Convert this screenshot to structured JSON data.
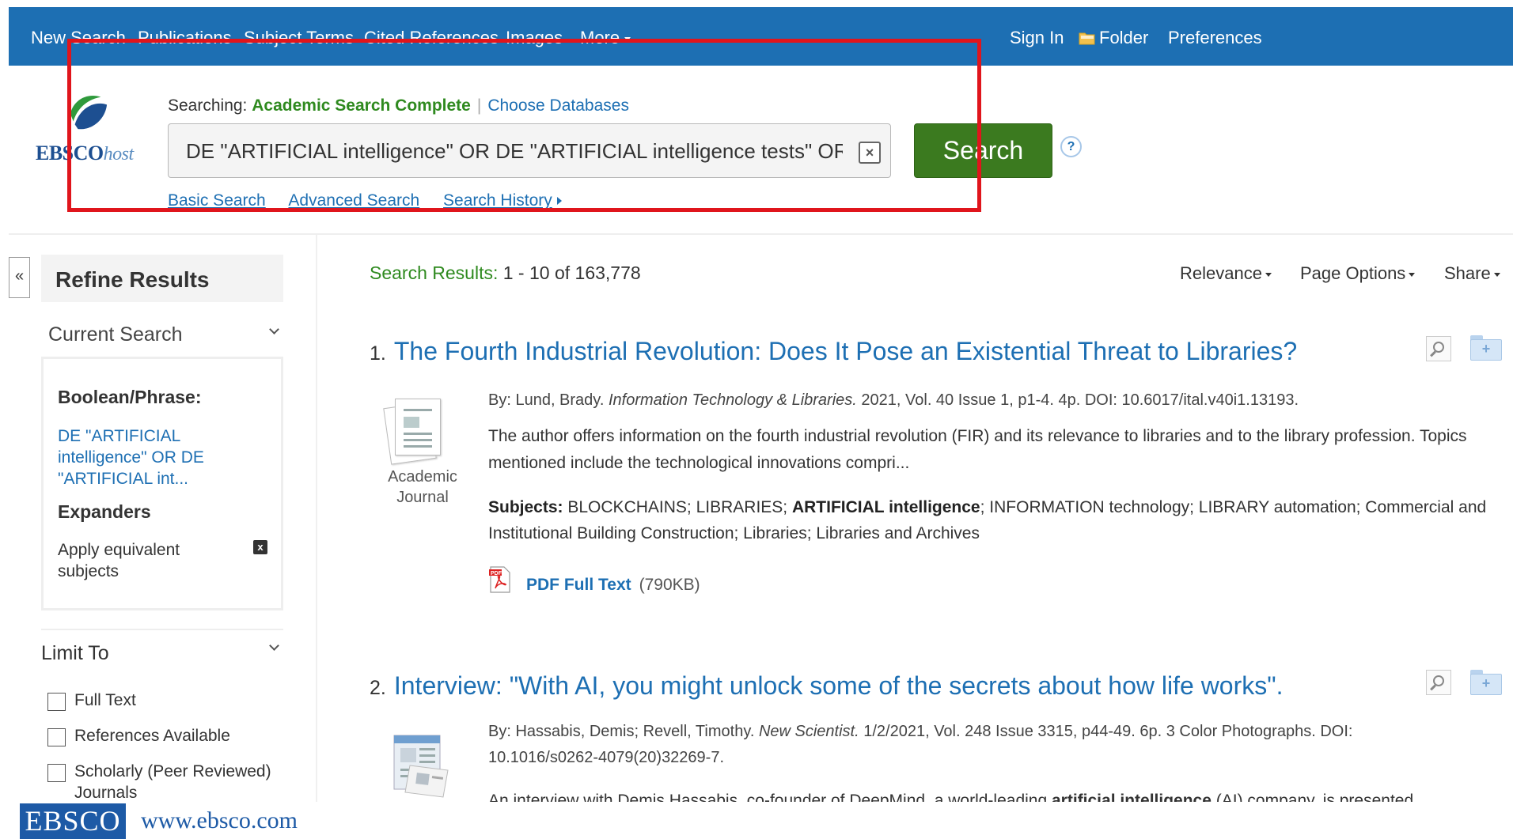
{
  "topnav": {
    "new_search": "New Search",
    "publications": "Publications",
    "subject_terms": "Subject Terms",
    "cited_references": "Cited References",
    "images": "Images",
    "more": "More",
    "sign_in": "Sign In",
    "folder": "Folder",
    "preferences": "Preferences"
  },
  "logo": {
    "ebsco": "EBSCO",
    "host": "host"
  },
  "search": {
    "searching_label": "Searching:",
    "database": "Academic Search Complete",
    "choose_databases": "Choose Databases",
    "query": "DE \"ARTIFICIAL intelligence\" OR DE \"ARTIFICIAL intelligence tests\" OR",
    "clear": "×",
    "button": "Search",
    "help": "?",
    "basic": "Basic Search",
    "advanced": "Advanced Search",
    "history": "Search History"
  },
  "sidebar": {
    "collapse": "«",
    "refine_title": "Refine Results",
    "current_search": "Current Search",
    "boolean_label": "Boolean/Phrase:",
    "boolean_value": "DE \"ARTIFICIAL intelligence\" OR DE \"ARTIFICIAL int...",
    "expanders_label": "Expanders",
    "expander_value": "Apply equivalent subjects",
    "remove": "x",
    "limit_to": "Limit To",
    "limits": [
      {
        "label": "Full Text"
      },
      {
        "label": "References Available"
      },
      {
        "label": "Scholarly (Peer Reviewed) Journals"
      }
    ]
  },
  "results": {
    "count_label": "Search Results:",
    "count_value": "1 - 10 of 163,778",
    "relevance": "Relevance",
    "page_options": "Page Options",
    "share": "Share",
    "items": [
      {
        "num": "1.",
        "title": "The Fourth Industrial Revolution: Does It Pose an Existential Threat to Libraries?",
        "by": "By: Lund, Brady.",
        "source": "Information Technology & Libraries.",
        "details": "2021, Vol. 40 Issue 1, p1-4. 4p. DOI: 10.6017/ital.v40i1.13193.",
        "abstract": "The author offers information on the fourth industrial revolution (FIR) and its relevance to libraries and to the library profession. Topics mentioned include the technological innovations compri...",
        "subjects_label": "Subjects:",
        "subjects_a": "BLOCKCHAINS; LIBRARIES;",
        "subjects_bold": "ARTIFICIAL intelligence",
        "subjects_b": "; INFORMATION technology; LIBRARY automation; Commercial and Institutional Building Construction; Libraries; Libraries and Archives",
        "type_line1": "Academic",
        "type_line2": "Journal",
        "pdf_label": "PDF Full Text",
        "pdf_size": "(790KB)"
      },
      {
        "num": "2.",
        "title": "Interview: \"With AI, you might unlock some of the secrets about how life works\".",
        "by": "By: Hassabis, Demis; Revell, Timothy.",
        "source": "New Scientist.",
        "details": "1/2/2021, Vol. 248 Issue 3315, p44-49. 6p. 3 Color Photographs. DOI:",
        "details2": "10.1016/s0262-4079(20)32269-7.",
        "abstract_a": "An interview with Demis Hassabis, co-founder of DeepMind, a world-leading",
        "abstract_bold": "artificial intelligence",
        "abstract_b": "(AI) company, is presented"
      }
    ]
  },
  "footer": {
    "logo": "EBSCO",
    "url": "www.ebsco.com"
  },
  "colors": {
    "topbar": "#1d6fb3",
    "link": "#1d6fb3",
    "green_label": "#2f8a1f",
    "search_button": "#3b7a1f",
    "highlight_box": "#e0151c"
  }
}
